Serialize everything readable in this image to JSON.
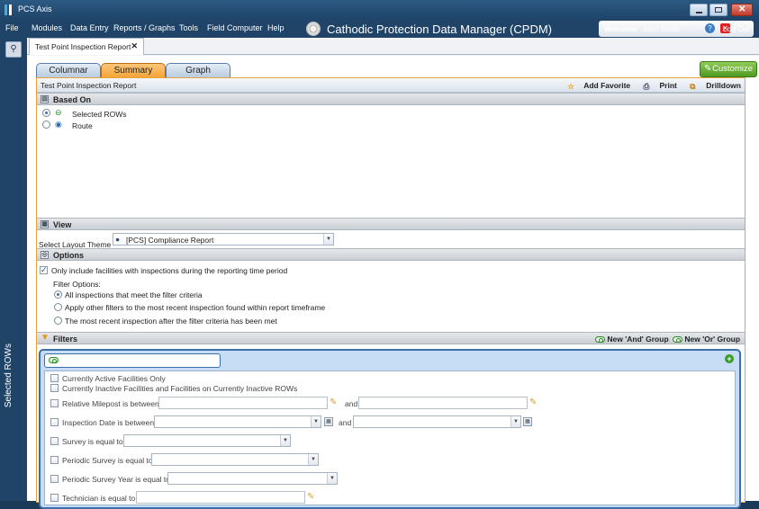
{
  "window": {
    "title": "PCS Axis"
  },
  "menu": {
    "items": [
      "File",
      "Modules",
      "Data Entry",
      "Reports / Graphs",
      "Tools",
      "Field Computer",
      "Help"
    ]
  },
  "app_heading": "Cathodic Protection Data Manager (CPDM)",
  "user": {
    "welcome": "Welcome",
    "name": "John Smith",
    "logout": "Log Out"
  },
  "left_panel": {
    "label": "Selected ROWs"
  },
  "doc_tab": {
    "label": "Test Point Inspection Report"
  },
  "view_tabs": [
    "Columnar",
    "Summary",
    "Graph"
  ],
  "customize_label": "Customize",
  "report": {
    "title": "Test Point Inspection Report",
    "add_favorite": "Add Favorite",
    "print": "Print",
    "drilldown": "Drilldown"
  },
  "based_on": {
    "heading": "Based On",
    "options": [
      "Selected ROWs",
      "Route"
    ]
  },
  "view": {
    "heading": "View",
    "layout_label": "Select Layout Theme",
    "layout_value": "[PCS] Compliance Report"
  },
  "options": {
    "heading": "Options",
    "only_include": "Only include facilities with inspections during the reporting time period",
    "filter_label": "Filter Options:",
    "filter_choices": [
      "All inspections that meet the filter criteria",
      "Apply other filters to the most recent inspection found within report timeframe",
      "The most recent inspection after the filter criteria has been met"
    ]
  },
  "filters": {
    "heading": "Filters",
    "new_and": "New 'And' Group",
    "new_or": "New 'Or' Group",
    "active_only": "Currently Active Facilities Only",
    "inactive": "Currently Inactive Facilities and Facilities on Currently Inactive ROWs",
    "milepost": "Relative Milepost is between",
    "and": "and",
    "inspection_date": "Inspection Date is between",
    "survey": "Survey is equal to",
    "periodic_survey": "Periodic Survey is equal to",
    "periodic_survey_year": "Periodic Survey Year is equal to",
    "technician": "Technician is equal to"
  },
  "colors": {
    "accent_orange": "#f3a233",
    "title_bar": "#1f4468",
    "customize_green": "#4f9a24"
  }
}
